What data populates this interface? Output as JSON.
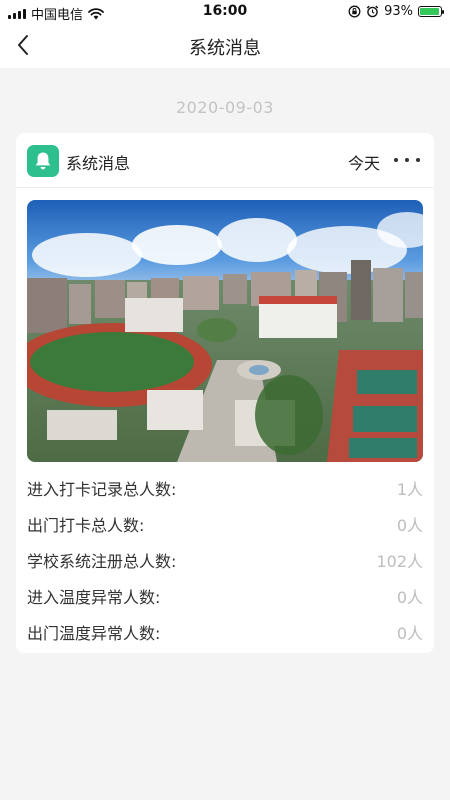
{
  "status_bar": {
    "carrier": "中国电信",
    "time": "16:00",
    "battery_pct": "93%",
    "battery_level": 0.93,
    "battery_color": "#34c759"
  },
  "nav": {
    "title": "系统消息",
    "back_icon": "chevron-left-icon"
  },
  "date": "2020-09-03",
  "message": {
    "app_icon": "bell-icon",
    "app_icon_color": "#2ebf8f",
    "title": "系统消息",
    "time": "今天",
    "image": "campus-aerial-photo",
    "stats": [
      {
        "label": "进入打卡记录总人数:",
        "value": "1人"
      },
      {
        "label": "出门打卡总人数:",
        "value": "0人"
      },
      {
        "label": "学校系统注册总人数:",
        "value": "102人"
      },
      {
        "label": "进入温度异常人数:",
        "value": "0人"
      },
      {
        "label": "出门温度异常人数:",
        "value": "0人"
      }
    ]
  }
}
